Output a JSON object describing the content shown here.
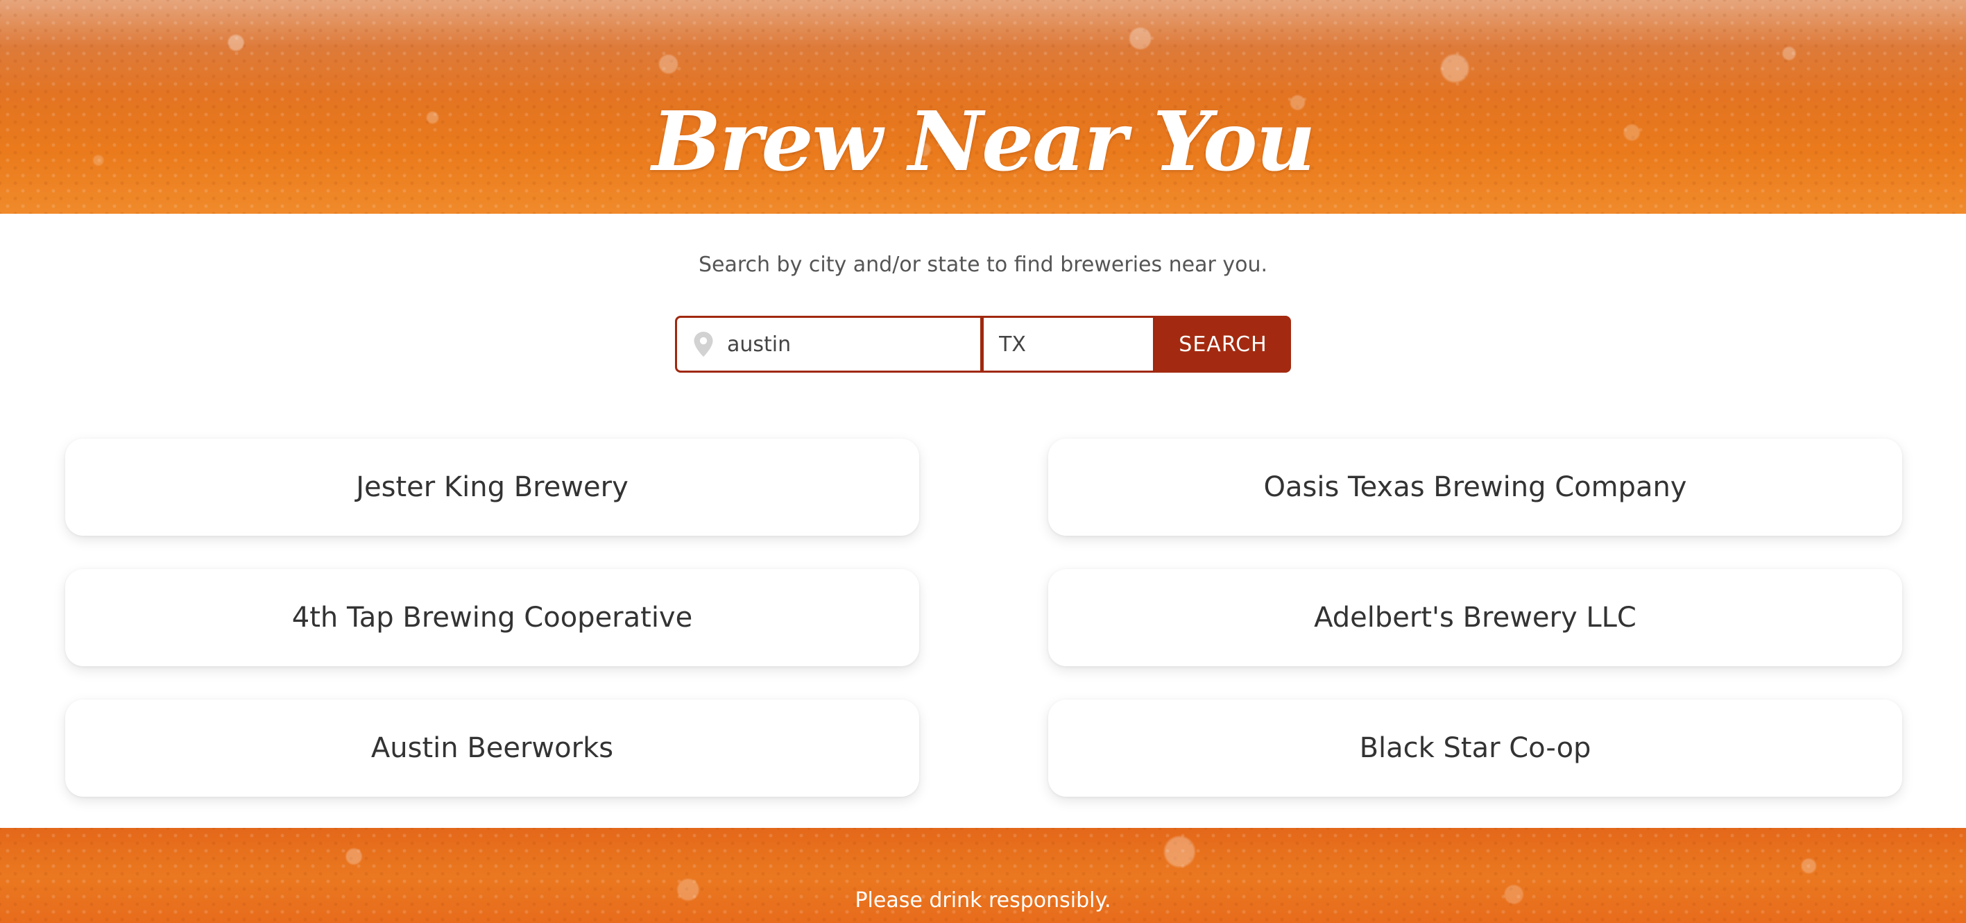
{
  "header": {
    "title": "Brew Near You"
  },
  "search": {
    "instructions": "Search by city and/or state to find breweries near you.",
    "city_value": "austin",
    "state_value": "TX",
    "button_label": "SEARCH"
  },
  "results": [
    "Jester King Brewery",
    "Oasis Texas Brewing Company",
    "4th Tap Brewing Cooperative",
    "Adelbert's Brewery LLC",
    "Austin Beerworks",
    "Black Star Co-op"
  ],
  "footer": {
    "text": "Please drink responsibly."
  },
  "icons": {
    "city_field": "map-pin-icon"
  },
  "colors": {
    "accent": "#a32a10",
    "beer": "#e37422"
  }
}
